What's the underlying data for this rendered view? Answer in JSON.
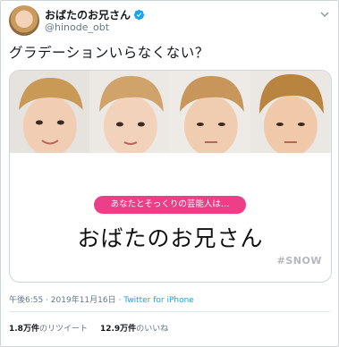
{
  "user": {
    "display_name": "おばたのお兄さん",
    "handle": "@hinode_obt",
    "verified": true
  },
  "tweet": {
    "text": "グラデーションいらなくない？",
    "timestamp": "午後6:55 · 2019年11月16日",
    "separator": " · ",
    "client": "Twitter for iPhone"
  },
  "card": {
    "pill_text": "あなたとそっくりの芸能人は…",
    "result_name": "おばたのお兄さん",
    "tag": "#SNOW"
  },
  "stats": {
    "retweets_value": "1.8万件",
    "retweets_label": "のリツイート",
    "likes_value": "12.9万件",
    "likes_label": "のいいね"
  },
  "colors": {
    "pill": "#ec3f87",
    "link": "#1da1f2",
    "verified": "#1da1f2"
  },
  "icons": [
    "verified-badge-icon",
    "chevron-down-icon"
  ]
}
